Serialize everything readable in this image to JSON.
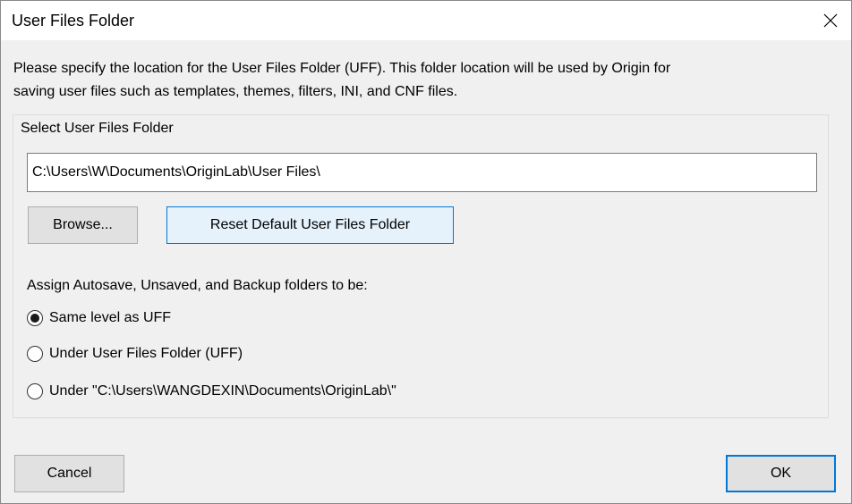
{
  "window": {
    "title": "User Files Folder"
  },
  "description": {
    "line1": "Please specify the location for the User Files Folder (UFF). This folder location will be used by Origin for",
    "line2": "saving user files such as templates, themes, filters, INI, and CNF files."
  },
  "group": {
    "label": "Select User Files Folder",
    "path_value": "C:\\Users\\W\\Documents\\OriginLab\\User Files\\",
    "browse_label": "Browse...",
    "reset_label": "Reset Default User Files Folder"
  },
  "assign": {
    "label": "Assign Autosave, Unsaved, and Backup folders to be:",
    "options": [
      {
        "label": "Same level as UFF",
        "selected": true
      },
      {
        "label": "Under User Files Folder (UFF)",
        "selected": false
      },
      {
        "label": "Under \"C:\\Users\\WANGDEXIN\\Documents\\OriginLab\\\"",
        "selected": false
      }
    ]
  },
  "footer": {
    "cancel_label": "Cancel",
    "ok_label": "OK"
  },
  "icons": {
    "close": "close-icon"
  },
  "colors": {
    "accent": "#0078d7",
    "reset_button_bg": "#e5f1fb",
    "dialog_bg": "#f0f0f0"
  }
}
